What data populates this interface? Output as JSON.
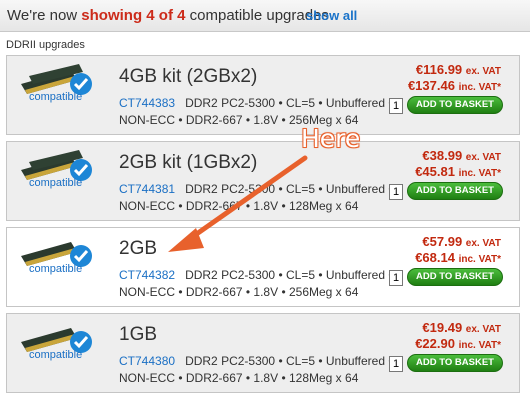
{
  "header": {
    "prefix": "We're now",
    "strong_text": "showing 4 of 4",
    "suffix": "compatible upgrades",
    "show_all": "show all"
  },
  "section_label": "DDRII upgrades",
  "compatible_label": "compatible",
  "qty_default": "1",
  "basket_label": "ADD TO BASKET",
  "annotation": {
    "text": "Here",
    "color": "#e8612c"
  },
  "products": [
    {
      "title": "4GB kit (2GBx2)",
      "part_number": "CT744383",
      "desc_line1": "DDR2 PC2-5300 • CL=5 • Unbuffered •",
      "desc_line2": "NON-ECC • DDR2-667 • 1.8V • 256Meg x 64",
      "price_ex": "€116.99",
      "price_inc": "€137.46",
      "ex_label": "ex. VAT",
      "inc_label": "inc. VAT*"
    },
    {
      "title": "2GB kit (1GBx2)",
      "part_number": "CT744381",
      "desc_line1": "DDR2 PC2-5300 • CL=5 • Unbuffered •",
      "desc_line2": "NON-ECC • DDR2-667 • 1.8V • 128Meg x 64",
      "price_ex": "€38.99",
      "price_inc": "€45.81",
      "ex_label": "ex. VAT",
      "inc_label": "inc. VAT*"
    },
    {
      "title": "2GB",
      "part_number": "CT744382",
      "desc_line1": "DDR2 PC2-5300 • CL=5 • Unbuffered •",
      "desc_line2": "NON-ECC • DDR2-667 • 1.8V • 256Meg x 64",
      "price_ex": "€57.99",
      "price_inc": "€68.14",
      "ex_label": "ex. VAT",
      "inc_label": "inc. VAT*"
    },
    {
      "title": "1GB",
      "part_number": "CT744380",
      "desc_line1": "DDR2 PC2-5300 • CL=5 • Unbuffered •",
      "desc_line2": "NON-ECC • DDR2-667 • 1.8V • 128Meg x 64",
      "price_ex": "€19.49",
      "price_inc": "€22.90",
      "ex_label": "ex. VAT",
      "inc_label": "inc. VAT*"
    }
  ],
  "colors": {
    "price": "#c2290f",
    "link": "#1a6fc4",
    "basket_button": "#2e9a22",
    "header_highlight": "#cc2b1a"
  }
}
